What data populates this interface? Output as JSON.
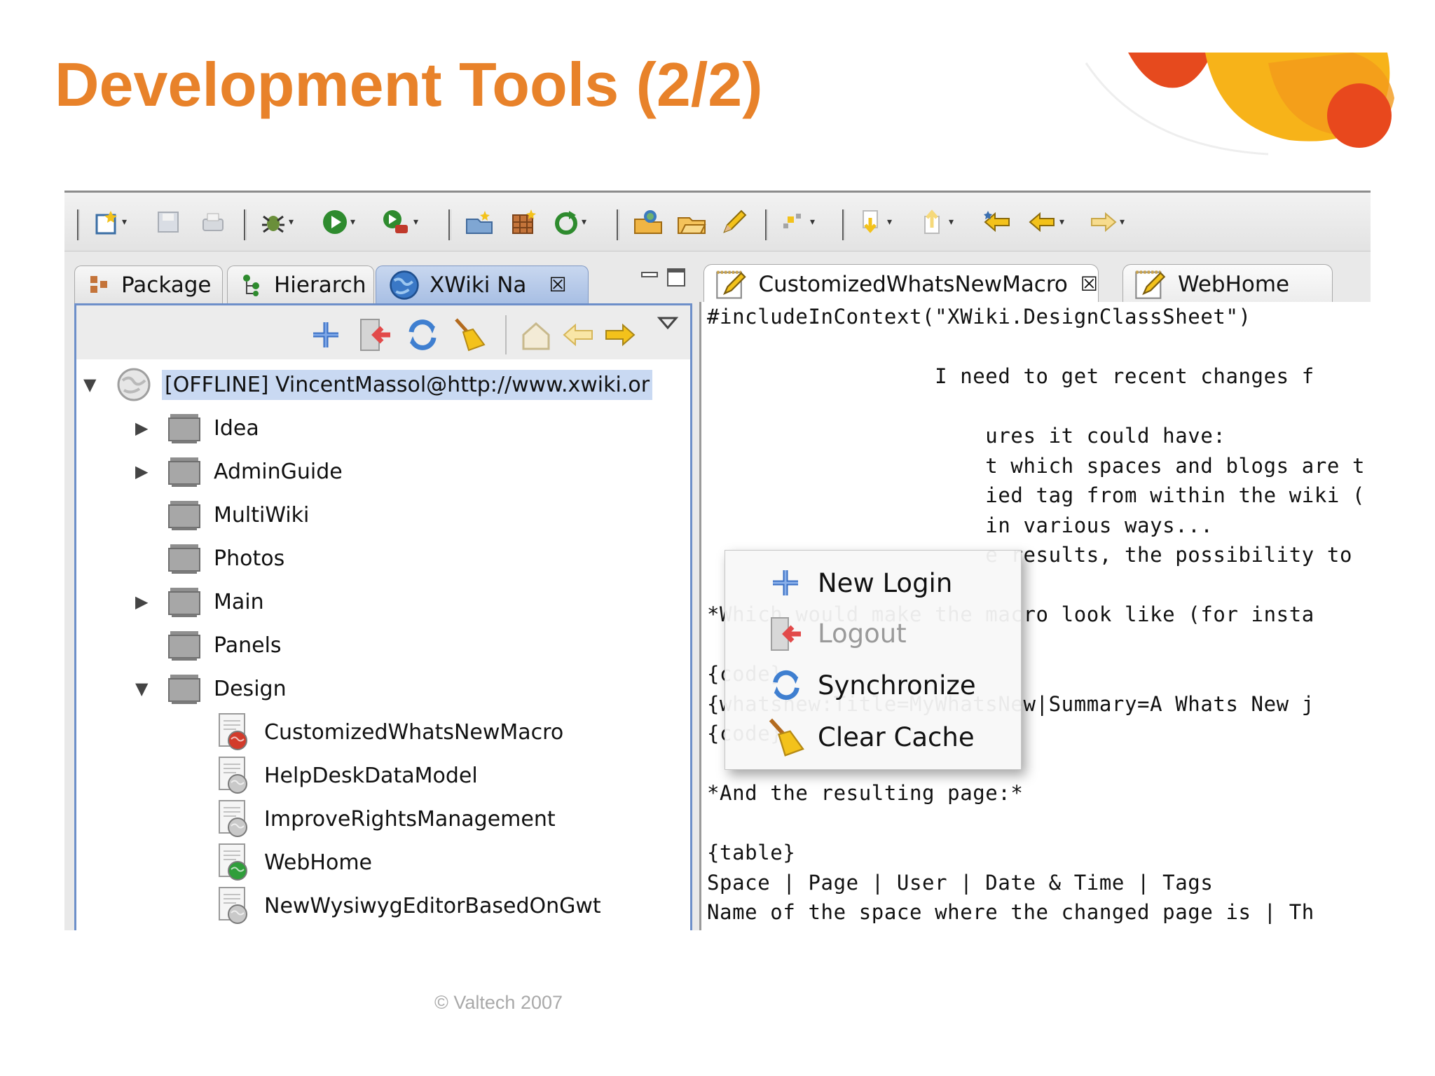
{
  "slide": {
    "title": "Development Tools (2/2)",
    "footer": "© Valtech 2007",
    "title_color": "#e8822a"
  },
  "toolbar": {
    "icons": [
      "new-wizard-icon",
      "save-icon",
      "print-icon",
      "debug-icon",
      "run-icon",
      "external-tools-icon",
      "open-type-icon",
      "open-resource-icon",
      "refresh-icon",
      "open-project-icon",
      "open-folder-icon",
      "edit-icon",
      "annotation-icon",
      "next-annotation-icon",
      "previous-annotation-icon",
      "last-edit-icon",
      "back-icon",
      "forward-icon"
    ]
  },
  "left_view": {
    "tabs": [
      {
        "label": "Package"
      },
      {
        "label": "Hierarch"
      },
      {
        "label": "XWiki Na",
        "active": true
      }
    ],
    "view_toolbar": [
      "add-icon",
      "logout-icon",
      "synchronize-icon",
      "clear-cache-icon",
      "home-icon",
      "back-icon",
      "forward-icon",
      "view-menu-icon"
    ],
    "tree": {
      "root": "[OFFLINE] VincentMassol@http://www.xwiki.or",
      "spaces": [
        {
          "label": "Idea",
          "expandable": true
        },
        {
          "label": "AdminGuide",
          "expandable": true
        },
        {
          "label": "MultiWiki",
          "expandable": false
        },
        {
          "label": "Photos",
          "expandable": false
        },
        {
          "label": "Main",
          "expandable": true
        },
        {
          "label": "Panels",
          "expandable": false
        },
        {
          "label": "Design",
          "expandable": true,
          "expanded": true
        }
      ],
      "pages": [
        {
          "label": "CustomizedWhatsNewMacro",
          "status": "red"
        },
        {
          "label": "HelpDeskDataModel",
          "status": "grey"
        },
        {
          "label": "ImproveRightsManagement",
          "status": "grey"
        },
        {
          "label": "WebHome",
          "status": "green"
        },
        {
          "label": "NewWysiwygEditorBasedOnGwt",
          "status": "grey"
        }
      ]
    }
  },
  "editor": {
    "tabs": [
      {
        "label": "CustomizedWhatsNewMacro",
        "active": true
      },
      {
        "label": "WebHome"
      }
    ],
    "lines": [
      "#includeInContext(\"XWiki.DesignClassSheet\")",
      "",
      "                  I need to get recent changes f",
      "",
      "                      ures it could have:",
      "                      t which spaces and blogs are t",
      "                      ied tag from within the wiki (",
      "                      in various ways...",
      "                      e results, the possibility to",
      "",
      "*Which would make the macro look like (for insta",
      "",
      "{code}",
      "{whatsnew:Title=MyWhatsNew|Summary=A Whats New j",
      "{code}",
      "",
      "*And the resulting page:*",
      "",
      "{table}",
      "Space | Page | User | Date & Time | Tags",
      "Name of the space where the changed page is | Th"
    ]
  },
  "context_menu": {
    "items": [
      {
        "label": "New Login",
        "icon": "add-icon",
        "enabled": true
      },
      {
        "label": "Logout",
        "icon": "logout-icon",
        "enabled": false
      },
      {
        "label": "Synchronize",
        "icon": "synchronize-icon",
        "enabled": true
      },
      {
        "label": "Clear Cache",
        "icon": "broom-icon",
        "enabled": true
      }
    ]
  }
}
